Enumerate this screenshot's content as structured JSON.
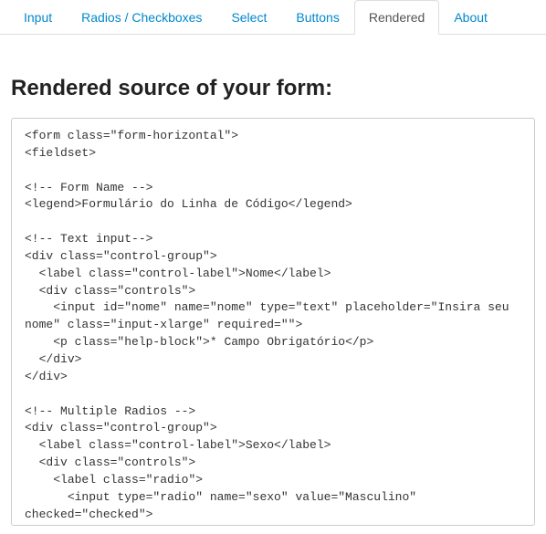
{
  "tabs": [
    {
      "label": "Input"
    },
    {
      "label": "Radios / Checkboxes"
    },
    {
      "label": "Select"
    },
    {
      "label": "Buttons"
    },
    {
      "label": "Rendered"
    },
    {
      "label": "About"
    }
  ],
  "active_tab_index": 4,
  "main": {
    "heading": "Rendered source of your form:",
    "code": "<form class=\"form-horizontal\">\n<fieldset>\n\n<!-- Form Name -->\n<legend>Formulário do Linha de Código</legend>\n\n<!-- Text input-->\n<div class=\"control-group\">\n  <label class=\"control-label\">Nome</label>\n  <div class=\"controls\">\n    <input id=\"nome\" name=\"nome\" type=\"text\" placeholder=\"Insira seu nome\" class=\"input-xlarge\" required=\"\">\n    <p class=\"help-block\">* Campo Obrigatório</p>\n  </div>\n</div>\n\n<!-- Multiple Radios -->\n<div class=\"control-group\">\n  <label class=\"control-label\">Sexo</label>\n  <div class=\"controls\">\n    <label class=\"radio\">\n      <input type=\"radio\" name=\"sexo\" value=\"Masculino\" checked=\"checked\">"
  }
}
